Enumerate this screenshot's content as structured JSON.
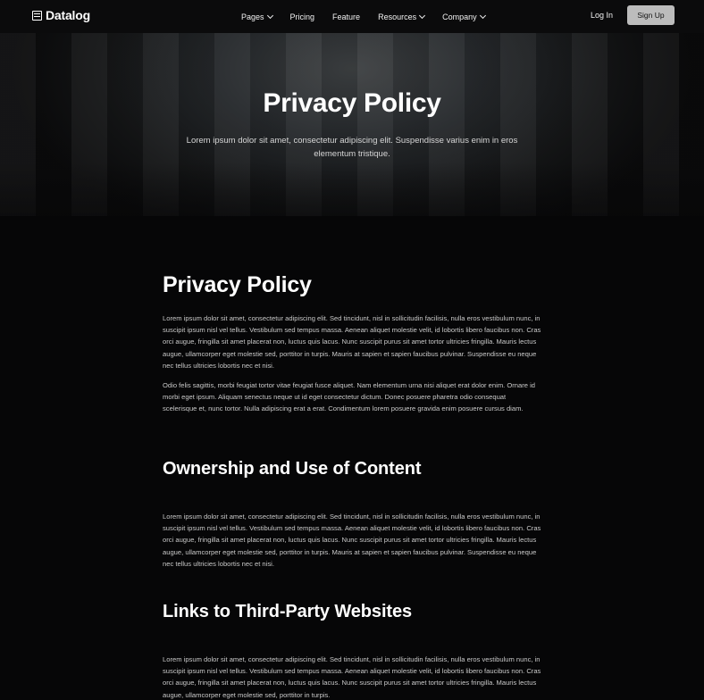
{
  "brand": {
    "name": "Datalog"
  },
  "nav": {
    "items": [
      {
        "label": "Pages",
        "dropdown": true
      },
      {
        "label": "Pricing",
        "dropdown": false
      },
      {
        "label": "Feature",
        "dropdown": false
      },
      {
        "label": "Resources",
        "dropdown": true
      },
      {
        "label": "Company",
        "dropdown": true
      }
    ],
    "login_label": "Log In",
    "signup_label": "Sign Up"
  },
  "hero": {
    "title": "Privacy Policy",
    "subtitle": "Lorem ipsum dolor sit amet, consectetur adipiscing elit. Suspendisse varius enim in eros elementum tristique."
  },
  "sections": [
    {
      "heading": "Privacy Policy",
      "paragraphs": [
        "Lorem ipsum dolor sit amet, consectetur adipiscing elit. Sed tincidunt, nisl in sollicitudin facilisis, nulla eros vestibulum nunc, in suscipit ipsum nisl vel tellus. Vestibulum sed tempus massa. Aenean aliquet molestie velit, id lobortis libero faucibus non. Cras orci augue, fringilla sit amet placerat non, luctus quis lacus. Nunc suscipit purus sit amet tortor ultricies fringilla. Mauris lectus augue, ullamcorper eget molestie sed, porttitor in turpis. Mauris at sapien et sapien faucibus pulvinar. Suspendisse eu neque nec tellus ultricies lobortis nec et nisi.",
        "Odio felis sagittis, morbi feugiat tortor vitae feugiat fusce aliquet. Nam elementum urna nisi aliquet erat dolor enim. Ornare id morbi eget ipsum. Aliquam senectus neque ut id eget consectetur dictum. Donec posuere pharetra odio consequat scelerisque et, nunc tortor. Nulla adipiscing erat a erat. Condimentum lorem posuere gravida enim posuere cursus diam."
      ]
    },
    {
      "heading": "Ownership and Use of Content",
      "paragraphs": [
        "Lorem ipsum dolor sit amet, consectetur adipiscing elit. Sed tincidunt, nisl in sollicitudin facilisis, nulla eros vestibulum nunc, in suscipit ipsum nisl vel tellus. Vestibulum sed tempus massa. Aenean aliquet molestie velit, id lobortis libero faucibus non. Cras orci augue, fringilla sit amet placerat non, luctus quis lacus. Nunc suscipit purus sit amet tortor ultricies fringilla. Mauris lectus augue, ullamcorper eget molestie sed, porttitor in turpis. Mauris at sapien et sapien faucibus pulvinar. Suspendisse eu neque nec tellus ultricies lobortis nec et nisi."
      ]
    },
    {
      "heading": "Links to Third-Party Websites",
      "paragraphs": [
        "Lorem ipsum dolor sit amet, consectetur adipiscing elit. Sed tincidunt, nisl in sollicitudin facilisis, nulla eros vestibulum nunc, in suscipit ipsum nisl vel tellus. Vestibulum sed tempus massa. Aenean aliquet molestie velit, id lobortis libero faucibus non. Cras orci augue, fringilla sit amet placerat non, luctus quis lacus. Nunc suscipit purus sit amet tortor ultricies fringilla. Mauris lectus augue, ullamcorper eget molestie sed, porttitor in turpis."
      ]
    }
  ]
}
